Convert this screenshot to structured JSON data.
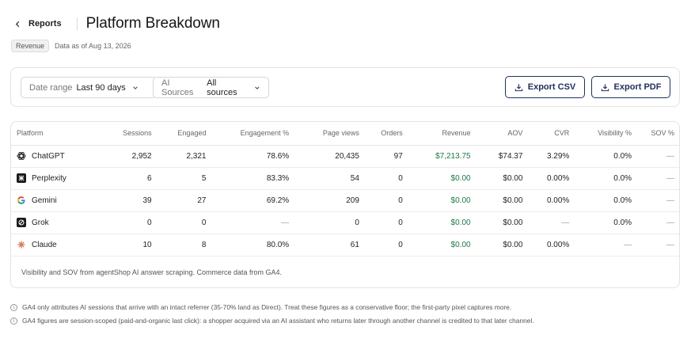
{
  "header": {
    "back_label": "Reports",
    "title": "Platform Breakdown"
  },
  "meta": {
    "badge": "Revenue",
    "as_of": "Data as of Aug 13, 2026"
  },
  "filters": {
    "date_range": {
      "label": "Date range",
      "value": "Last 90 days"
    },
    "ai_sources": {
      "label": "AI Sources",
      "value": "All sources"
    },
    "export_csv": "Export CSV",
    "export_pdf": "Export PDF"
  },
  "table": {
    "columns": [
      "Platform",
      "Sessions",
      "Engaged",
      "Engagement %",
      "Page views",
      "Orders",
      "Revenue",
      "AOV",
      "CVR",
      "Visibility %",
      "SOV %"
    ],
    "rows": [
      {
        "icon": "chatgpt-icon",
        "platform": "ChatGPT",
        "sessions": "2,952",
        "engaged": "2,321",
        "engagement": "78.6%",
        "page_views": "20,435",
        "orders": "97",
        "revenue": "$7,213.75",
        "aov": "$74.37",
        "cvr": "3.29%",
        "visibility": "0.0%",
        "sov": "—"
      },
      {
        "icon": "perplexity-icon",
        "platform": "Perplexity",
        "sessions": "6",
        "engaged": "5",
        "engagement": "83.3%",
        "page_views": "54",
        "orders": "0",
        "revenue": "$0.00",
        "aov": "$0.00",
        "cvr": "0.00%",
        "visibility": "0.0%",
        "sov": "—"
      },
      {
        "icon": "gemini-icon",
        "platform": "Gemini",
        "sessions": "39",
        "engaged": "27",
        "engagement": "69.2%",
        "page_views": "209",
        "orders": "0",
        "revenue": "$0.00",
        "aov": "$0.00",
        "cvr": "0.00%",
        "visibility": "0.0%",
        "sov": "—"
      },
      {
        "icon": "grok-icon",
        "platform": "Grok",
        "sessions": "0",
        "engaged": "0",
        "engagement": "—",
        "page_views": "0",
        "orders": "0",
        "revenue": "$0.00",
        "aov": "$0.00",
        "cvr": "—",
        "visibility": "0.0%",
        "sov": "—"
      },
      {
        "icon": "claude-icon",
        "platform": "Claude",
        "sessions": "10",
        "engaged": "8",
        "engagement": "80.0%",
        "page_views": "61",
        "orders": "0",
        "revenue": "$0.00",
        "aov": "$0.00",
        "cvr": "0.00%",
        "visibility": "—",
        "sov": "—"
      }
    ],
    "footnote": "Visibility and SOV from agentShop AI answer scraping. Commerce data from GA4."
  },
  "notes": [
    "GA4 only attributes AI sessions that arrive with an intact referrer (35-70% land as Direct). Treat these figures as a conservative floor; the first-party pixel captures more.",
    "GA4 figures are session-scoped (paid-and-organic last click): a shopper acquired via an AI assistant who returns later through another channel is credited to that later channel."
  ],
  "colors": {
    "accent": "#20315c",
    "revenue_green": "#1c7a48",
    "claude_orange": "#d97757"
  }
}
